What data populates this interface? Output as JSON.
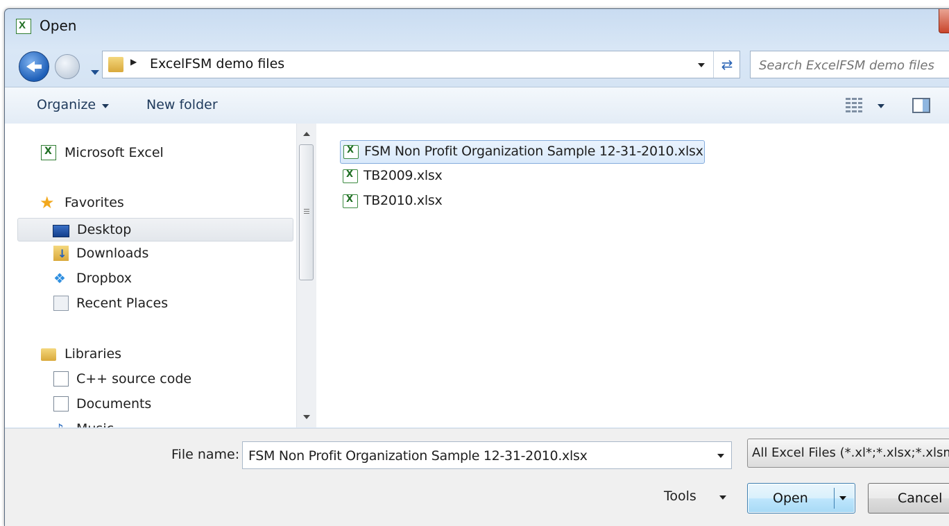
{
  "window": {
    "title": "Open"
  },
  "address": {
    "breadcrumb": "ExcelFSM demo files",
    "search_placeholder": "Search ExcelFSM demo files"
  },
  "toolbar": {
    "organize_label": "Organize",
    "new_folder_label": "New folder"
  },
  "nav": {
    "items": [
      {
        "label": "Microsoft Excel",
        "icon": "excel-icon"
      },
      {
        "label": "Favorites",
        "icon": "star-icon"
      },
      {
        "label": "Desktop",
        "icon": "desktop-icon",
        "selected": true
      },
      {
        "label": "Downloads",
        "icon": "downloads-folder-icon"
      },
      {
        "label": "Dropbox",
        "icon": "dropbox-icon"
      },
      {
        "label": "Recent Places",
        "icon": "recent-places-icon"
      },
      {
        "label": "Libraries",
        "icon": "libraries-icon"
      },
      {
        "label": "C++ source code",
        "icon": "document-library-icon"
      },
      {
        "label": "Documents",
        "icon": "documents-icon"
      },
      {
        "label": "Music",
        "icon": "music-icon"
      }
    ]
  },
  "files": [
    {
      "name": "FSM Non Profit Organization Sample 12-31-2010.xlsx",
      "selected": true
    },
    {
      "name": "TB2009.xlsx"
    },
    {
      "name": "TB2010.xlsx"
    }
  ],
  "footer": {
    "file_name_label": "File name:",
    "file_name_value": "FSM Non Profit Organization Sample 12-31-2010.xlsx",
    "file_type_value": "All Excel Files (*.xl*;*.xlsx;*.xlsm;",
    "tools_label": "Tools",
    "open_label": "Open",
    "cancel_label": "Cancel"
  },
  "colors": {
    "accent": "#3c7fb1",
    "selection_fill": "#d9e9fb",
    "excel_green": "#1f6e23"
  }
}
